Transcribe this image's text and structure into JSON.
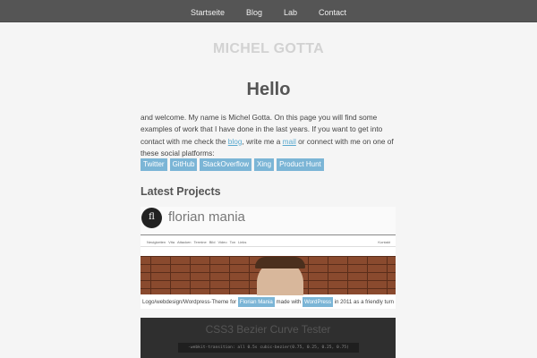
{
  "nav": {
    "items": [
      "Startseite",
      "Blog",
      "Lab",
      "Contact"
    ]
  },
  "site_title": "MICHEL GOTTA",
  "hello": "Hello",
  "intro": {
    "part1": "and welcome. My name is Michel Gotta. On this page you will find some examples of work that I have done in the last years. If you want to get into contact with me check the ",
    "blog_link": "blog",
    "part2": ", write me a ",
    "mail_link": "mail",
    "part3": " or connect with me on one of these social platforms:"
  },
  "social": [
    "Twitter",
    "GitHub",
    "StackOverflow",
    "Xing",
    "Product Hunt"
  ],
  "section_title": "Latest Projects",
  "project1": {
    "logo": "fl",
    "brand": "florian mania",
    "nav": [
      "Neuigkeiten",
      "Vita",
      "Attacken",
      "Termine",
      "Bild",
      "Video",
      "Ton",
      "Links"
    ],
    "contact": "Kontakt",
    "caption_before": "Logo/webdesign/Wordpress-Theme for ",
    "caption_tag1": "Florian Mania",
    "caption_mid": " made with ",
    "caption_tag2": "WordPress",
    "caption_after": " in 2011 as a friendly turn"
  },
  "project2": {
    "title": "CSS3 Bezier Curve Tester",
    "code": "-webkit-transition: all 0.5s cubic-bezier(0.75, 0.25, 0.25, 0.75)"
  },
  "colors": {
    "nav_bg": "#555555",
    "accent": "#7bb5d6",
    "link": "#5aa9cf",
    "background": "#f5f5f5"
  }
}
